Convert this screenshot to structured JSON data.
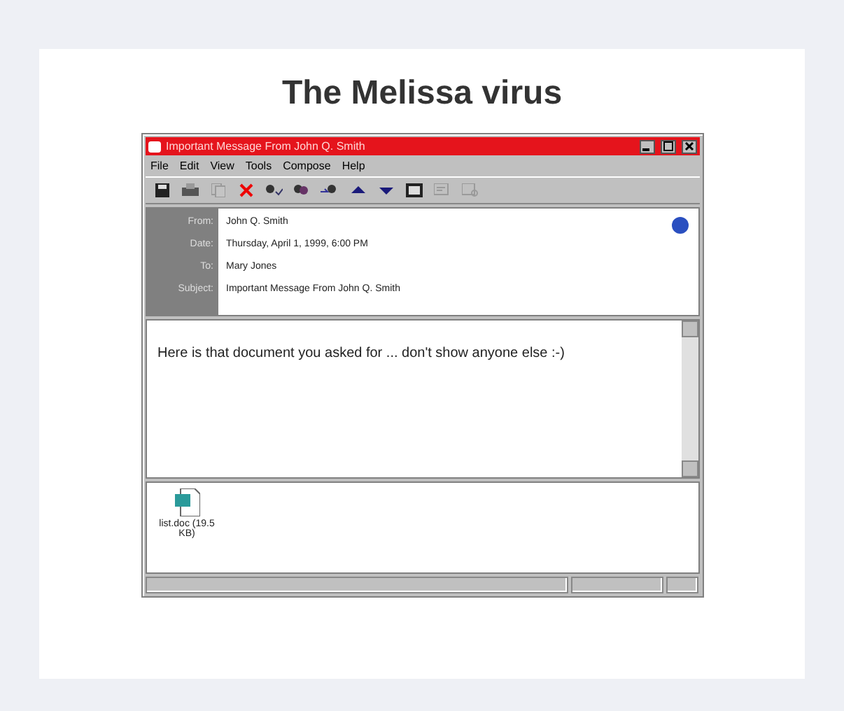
{
  "slide_title": "The Melissa virus",
  "window": {
    "title": "Important Message From John Q. Smith",
    "controls": [
      {
        "kind": "minimize"
      },
      {
        "kind": "maximize"
      },
      {
        "kind": "close"
      }
    ]
  },
  "menu": [
    "File",
    "Edit",
    "View",
    "Tools",
    "Compose",
    "Help"
  ],
  "toolbar": [
    {
      "kind": "save",
      "disabled": false
    },
    {
      "kind": "print",
      "disabled": false
    },
    {
      "kind": "copy",
      "disabled": true
    },
    {
      "kind": "delete",
      "disabled": false
    },
    {
      "kind": "reply",
      "disabled": false
    },
    {
      "kind": "reply-all",
      "disabled": false
    },
    {
      "kind": "forward",
      "disabled": false
    },
    {
      "kind": "up",
      "disabled": false
    },
    {
      "kind": "down",
      "disabled": false
    },
    {
      "kind": "address-book",
      "disabled": false
    },
    {
      "kind": "message",
      "disabled": true
    },
    {
      "kind": "attach",
      "disabled": true
    }
  ],
  "header_fields": [
    {
      "label": "From:",
      "value": "John Q. Smith"
    },
    {
      "label": "Date:",
      "value": "Thursday, April 1, 1999, 6:00 PM"
    },
    {
      "label": "To:",
      "value": "Mary Jones"
    },
    {
      "label": "Subject:",
      "value": "Important Message From John Q. Smith"
    }
  ],
  "body": "Here is that document you asked for ... don't show anyone else :-)",
  "attachments": [
    {
      "name": "list.doc (19.5 KB)"
    }
  ]
}
